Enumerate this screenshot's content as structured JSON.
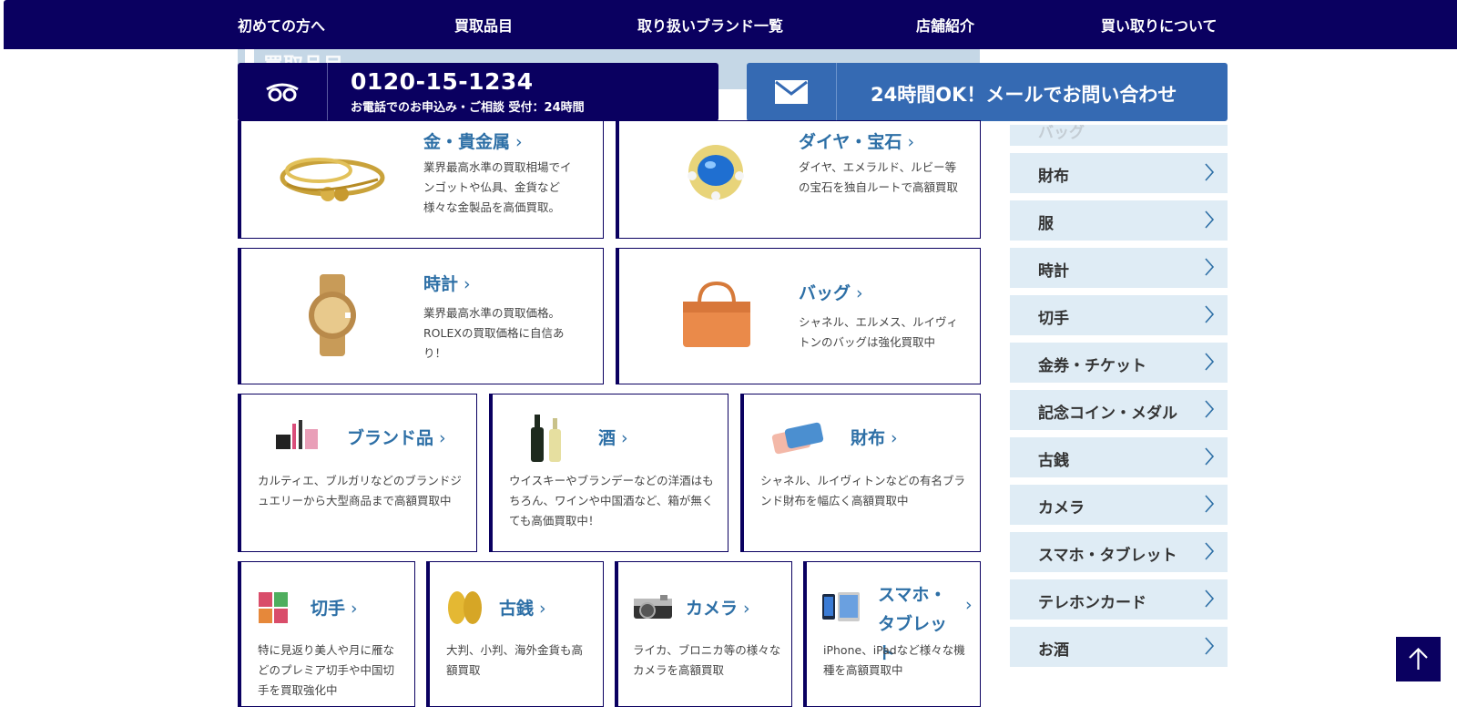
{
  "nav": {
    "items": [
      "初めての方へ",
      "買取品目",
      "取り扱いブランド一覧",
      "店舗紹介",
      "買い取りについて"
    ]
  },
  "section_title": "買取品目",
  "contact": {
    "phone_number": "0120-15-1234",
    "phone_sub": "お電話でのお申込み・ご相談 受付：24時間",
    "mail_label": "24時間OK！メールでお問い合わせ",
    "phone_icon": "free-dial-icon",
    "mail_icon": "envelope-icon"
  },
  "categories": [
    {
      "title": "金・貴金属",
      "desc": "業界最高水準の買取相場でインゴットや仏具、金貨など様々な金製品を高価買取。",
      "icon": "gold-jewelry-image"
    },
    {
      "title": "ダイヤ・宝石",
      "desc": "ダイヤ、エメラルド、ルビー等の宝石を独自ルートで高額買取",
      "icon": "gemstone-ring-image"
    },
    {
      "title": "時計",
      "desc": "業界最高水準の買取価格。ROLEXの買取価格に自信あり！",
      "icon": "watch-image"
    },
    {
      "title": "バッグ",
      "desc": "シャネル、エルメス、ルイヴィトンのバッグは強化買取中",
      "icon": "handbag-image"
    },
    {
      "title": "ブランド品",
      "desc": "カルティエ、ブルガリなどのブランドジュエリーから大型商品まで高額買取中",
      "icon": "cosmetics-image"
    },
    {
      "title": "酒",
      "desc": "ウイスキーやブランデーなどの洋酒はもちろん、ワインや中国酒など、箱が無くても高価買取中！",
      "icon": "wine-bottles-image"
    },
    {
      "title": "財布",
      "desc": "シャネル、ルイヴィトンなどの有名ブランド財布を幅広く高額買取中",
      "icon": "wallet-image"
    },
    {
      "title": "切手",
      "desc": "特に見返り美人や月に雁などのプレミア切手や中国切手を買取強化中",
      "icon": "stamps-image"
    },
    {
      "title": "古銭",
      "desc": "大判、小判、海外金貨も高額買取",
      "icon": "old-coins-image"
    },
    {
      "title": "カメラ",
      "desc": "ライカ、ブロニカ等の様々なカメラを高額買取",
      "icon": "camera-image"
    },
    {
      "title": "スマホ・タブレット",
      "desc": "iPhone、iPadなど様々な機種を高額買取中",
      "icon": "smartphone-tablet-image"
    }
  ],
  "sidebar": {
    "items": [
      "バッグ",
      "財布",
      "服",
      "時計",
      "切手",
      "金券・チケット",
      "記念コイン・メダル",
      "古銭",
      "カメラ",
      "スマホ・タブレット",
      "テレホンカード",
      "お酒"
    ]
  },
  "colors": {
    "navy": "#0a0060",
    "accent_blue": "#356ab3",
    "title_blue": "#2d6fa6",
    "sidebar_bg": "#dfecf5"
  },
  "scroll_top_icon": "arrow-up-icon"
}
